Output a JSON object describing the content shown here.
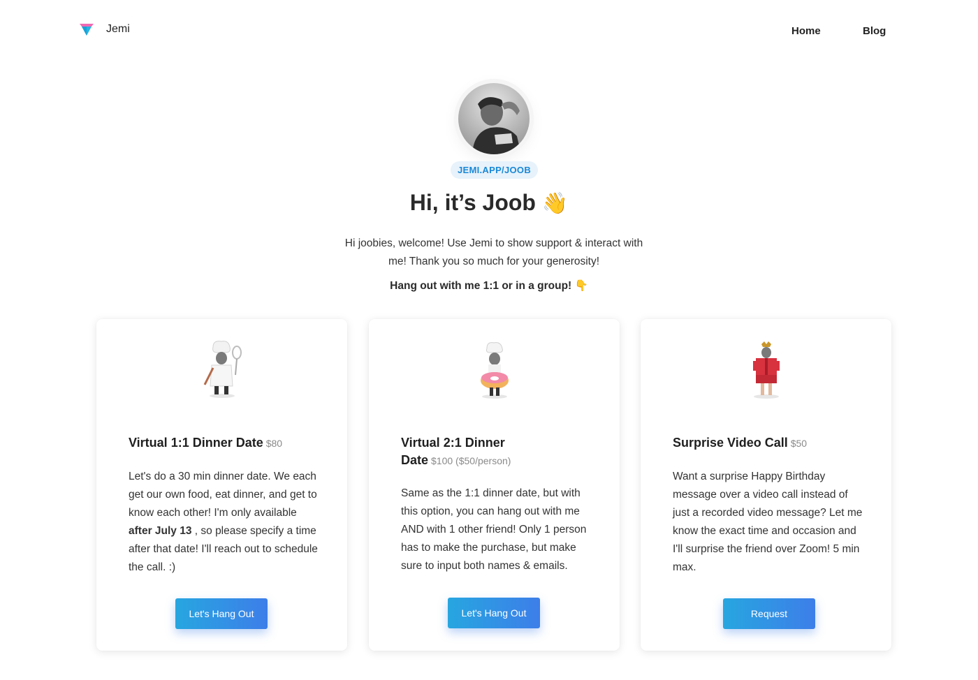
{
  "nav": {
    "brand_name": "Jemi",
    "home_label": "Home",
    "blog_label": "Blog"
  },
  "profile": {
    "handle": "JEMI.APP/JOOB",
    "title": "Hi, it’s Joob",
    "title_emoji": "👋",
    "bio": "Hi joobies, welcome! Use Jemi to show support & interact with me! Thank you so much for your generosity!",
    "cta": "Hang out with me 1:1 or in a group!",
    "cta_emoji": "👇"
  },
  "cards": [
    {
      "title": "Virtual 1:1 Dinner Date",
      "price": "$80",
      "desc_before": "Let's do a 30 min dinner date. We each get our own food, eat dinner, and get to know each other! I'm only available ",
      "desc_bold": "after July 13",
      "desc_after": " , so please specify a time after that date! I'll reach out to schedule the call. :)",
      "button_label": "Let's Hang Out",
      "figure_icon": "chef-with-whisk-icon"
    },
    {
      "title": "Virtual 2:1 Dinner Date",
      "price": "$100 ($50/person)",
      "desc": "Same as the 1:1 dinner date, but with this option, you can hang out with me AND with 1 other friend! Only 1 person has to make the purchase, but make sure to input both names & emails.",
      "button_label": "Let's Hang Out",
      "figure_icon": "chef-in-donut-icon"
    },
    {
      "title": "Surprise Video Call",
      "price": "$50",
      "desc": "Want a surprise Happy Birthday message over a video call instead of just a recorded video message? Let me know the exact time and occasion and I'll surprise the friend over Zoom! 5 min max.",
      "button_label": "Request",
      "figure_icon": "gift-box-costume-icon"
    }
  ],
  "colors": {
    "accent_blue": "#1a88d6",
    "pill_bg": "#e7f2fb",
    "button_gradient_start": "#27a6e0",
    "button_gradient_end": "#3d7ee9",
    "logo_pink": "#f06ab3",
    "logo_cyan": "#22b5e6"
  }
}
